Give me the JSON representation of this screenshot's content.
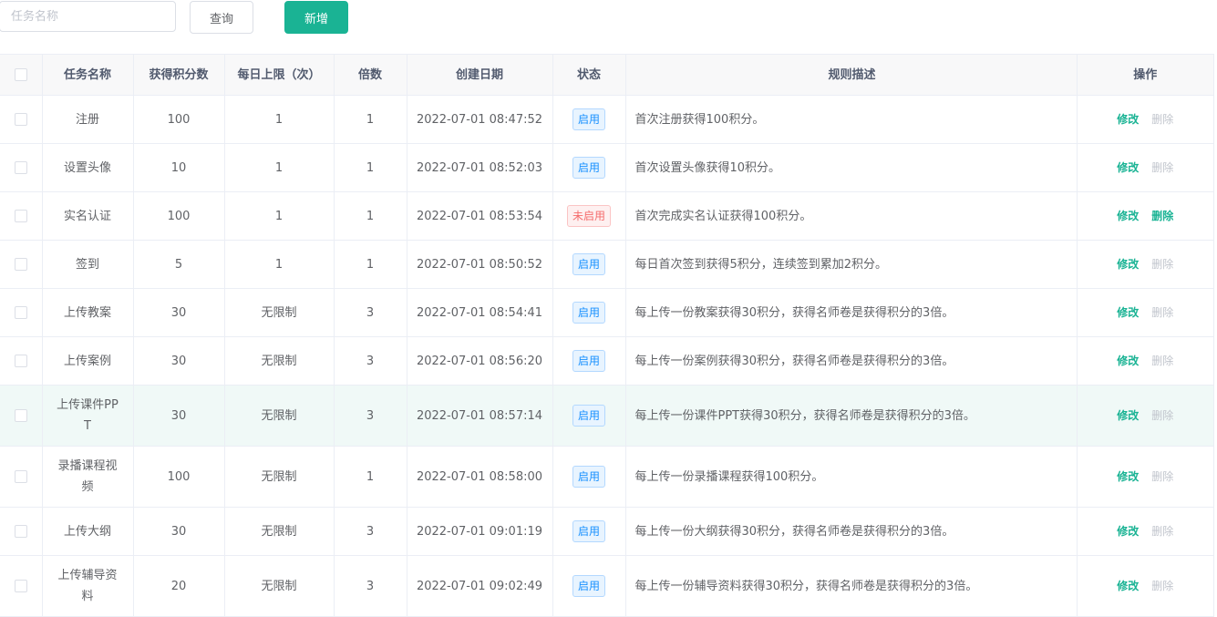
{
  "toolbar": {
    "search_placeholder": "任务名称",
    "search_value": "",
    "query_label": "查询",
    "add_label": "新增"
  },
  "colors": {
    "primary": "#1ab394",
    "enabled_tag": "#1890ff",
    "disabled_tag": "#f56c6c",
    "disabled_link": "#c0c4cc"
  },
  "table": {
    "headers": [
      "任务名称",
      "获得积分数",
      "每日上限（次）",
      "倍数",
      "创建日期",
      "状态",
      "规则描述",
      "操作"
    ],
    "edit_label": "修改",
    "delete_label": "删除",
    "rows": [
      {
        "name": "注册",
        "points": "100",
        "limit": "1",
        "multiplier": "1",
        "date": "2022-07-01 08:47:52",
        "status": "启用",
        "enabled": true,
        "desc": "首次注册获得100积分。"
      },
      {
        "name": "设置头像",
        "points": "10",
        "limit": "1",
        "multiplier": "1",
        "date": "2022-07-01 08:52:03",
        "status": "启用",
        "enabled": true,
        "desc": "首次设置头像获得10积分。"
      },
      {
        "name": "实名认证",
        "points": "100",
        "limit": "1",
        "multiplier": "1",
        "date": "2022-07-01 08:53:54",
        "status": "未启用",
        "enabled": false,
        "desc": "首次完成实名认证获得100积分。"
      },
      {
        "name": "签到",
        "points": "5",
        "limit": "1",
        "multiplier": "1",
        "date": "2022-07-01 08:50:52",
        "status": "启用",
        "enabled": true,
        "desc": "每日首次签到获得5积分，连续签到累加2积分。"
      },
      {
        "name": "上传教案",
        "points": "30",
        "limit": "无限制",
        "multiplier": "3",
        "date": "2022-07-01 08:54:41",
        "status": "启用",
        "enabled": true,
        "desc": "每上传一份教案获得30积分，获得名师卷是获得积分的3倍。"
      },
      {
        "name": "上传案例",
        "points": "30",
        "limit": "无限制",
        "multiplier": "3",
        "date": "2022-07-01 08:56:20",
        "status": "启用",
        "enabled": true,
        "desc": "每上传一份案例获得30积分，获得名师卷是获得积分的3倍。"
      },
      {
        "name": "上传课件PPT",
        "points": "30",
        "limit": "无限制",
        "multiplier": "3",
        "date": "2022-07-01 08:57:14",
        "status": "启用",
        "enabled": true,
        "desc": "每上传一份课件PPT获得30积分，获得名师卷是获得积分的3倍。"
      },
      {
        "name": "录播课程视频",
        "points": "100",
        "limit": "无限制",
        "multiplier": "1",
        "date": "2022-07-01 08:58:00",
        "status": "启用",
        "enabled": true,
        "desc": "每上传一份录播课程获得100积分。"
      },
      {
        "name": "上传大纲",
        "points": "30",
        "limit": "无限制",
        "multiplier": "3",
        "date": "2022-07-01 09:01:19",
        "status": "启用",
        "enabled": true,
        "desc": "每上传一份大纲获得30积分，获得名师卷是获得积分的3倍。"
      },
      {
        "name": "上传辅导资料",
        "points": "20",
        "limit": "无限制",
        "multiplier": "3",
        "date": "2022-07-01 09:02:49",
        "status": "启用",
        "enabled": true,
        "desc": "每上传一份辅导资料获得30积分，获得名师卷是获得积分的3倍。"
      }
    ]
  }
}
